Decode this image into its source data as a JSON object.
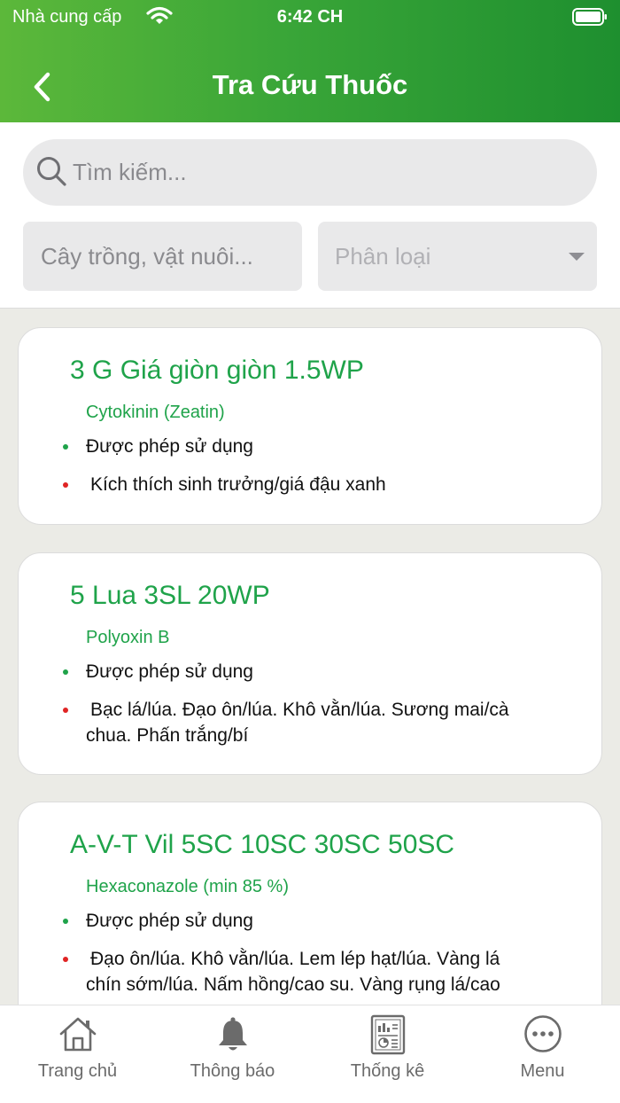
{
  "status_bar": {
    "carrier": "Nhà cung cấp",
    "time": "6:42 CH"
  },
  "header": {
    "title": "Tra Cứu Thuốc"
  },
  "search": {
    "placeholder": "Tìm kiếm..."
  },
  "filters": {
    "crop_placeholder": "Cây trồng, vật nuôi...",
    "category_label": "Phân loại"
  },
  "products": [
    {
      "name": "3 G Giá giòn giòn 1.5WP",
      "ingredient": "Cytokinin (Zeatin)",
      "status": "Được phép sử dụng",
      "usage_lines": [
        "Kích thích sinh trưởng/giá đậu xanh"
      ]
    },
    {
      "name": "5 Lua 3SL 20WP",
      "ingredient": "Polyoxin B",
      "status": "Được phép sử dụng",
      "usage_lines": [
        "Bạc lá/lúa. Đạo ôn/lúa. Khô vằn/lúa. Sương mai/cà",
        "chua. Phấn trắng/bí"
      ]
    },
    {
      "name": "A-V-T Vil 5SC 10SC 30SC 50SC",
      "ingredient": "Hexaconazole (min 85 %)",
      "status": "Được phép sử dụng",
      "usage_lines": [
        "Đạo ôn/lúa. Khô vằn/lúa. Lem lép hạt/lúa. Vàng lá",
        "chín sớm/lúa. Nấm hồng/cao su. Vàng rụng lá/cao"
      ]
    }
  ],
  "tabs": [
    {
      "label": "Trang chủ",
      "icon": "home-icon"
    },
    {
      "label": "Thông báo",
      "icon": "bell-icon"
    },
    {
      "label": "Thống kê",
      "icon": "report-icon"
    },
    {
      "label": "Menu",
      "icon": "more-icon"
    }
  ],
  "colors": {
    "primary_green": "#1fa34a",
    "header_start": "#5cb83a",
    "header_end": "#1e8f2f",
    "usage_dot": "#e02424"
  }
}
